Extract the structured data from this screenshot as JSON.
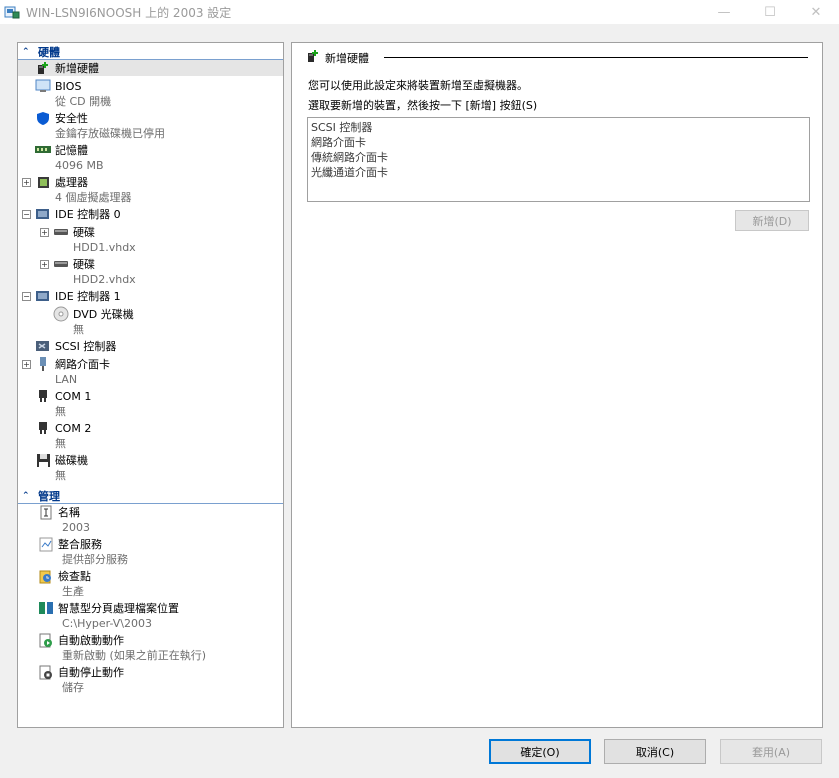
{
  "window": {
    "title": "WIN-LSN9I6NOOSH 上的 2003 設定",
    "minimize": "—",
    "maximize": "☐",
    "close": "✕"
  },
  "tree": {
    "hardware_section": "硬體",
    "hardware": [
      {
        "label": "新增硬體",
        "sub": "",
        "icon": "add-hardware-icon",
        "expand": "",
        "indent": 0,
        "selected": true
      },
      {
        "label": "BIOS",
        "sub": "從 CD 開機",
        "icon": "bios-icon",
        "expand": "",
        "indent": 0
      },
      {
        "label": "安全性",
        "sub": "金鑰存放磁碟機已停用",
        "icon": "shield-icon",
        "expand": "",
        "indent": 0
      },
      {
        "label": "記憶體",
        "sub": "4096 MB",
        "icon": "memory-icon",
        "expand": "",
        "indent": 0
      },
      {
        "label": "處理器",
        "sub": "4 個虛擬處理器",
        "icon": "processor-icon",
        "expand": "+",
        "indent": 0
      },
      {
        "label": "IDE 控制器 0",
        "sub": "",
        "icon": "ide-controller-icon",
        "expand": "−",
        "indent": 0
      },
      {
        "label": "硬碟",
        "sub": "HDD1.vhdx",
        "icon": "hard-drive-icon",
        "expand": "+",
        "indent": 1
      },
      {
        "label": "硬碟",
        "sub": "HDD2.vhdx",
        "icon": "hard-drive-icon",
        "expand": "+",
        "indent": 1
      },
      {
        "label": "IDE 控制器 1",
        "sub": "",
        "icon": "ide-controller-icon",
        "expand": "−",
        "indent": 0
      },
      {
        "label": "DVD 光碟機",
        "sub": "無",
        "icon": "dvd-icon",
        "expand": "",
        "indent": 1
      },
      {
        "label": "SCSI 控制器",
        "sub": "",
        "icon": "scsi-controller-icon",
        "expand": "",
        "indent": 0
      },
      {
        "label": "網路介面卡",
        "sub": "LAN",
        "icon": "network-adapter-icon",
        "expand": "+",
        "indent": 0
      },
      {
        "label": "COM 1",
        "sub": "無",
        "icon": "com-port-icon",
        "expand": "",
        "indent": 0
      },
      {
        "label": "COM 2",
        "sub": "無",
        "icon": "com-port-icon",
        "expand": "",
        "indent": 0
      },
      {
        "label": "磁碟機",
        "sub": "無",
        "icon": "floppy-icon",
        "expand": "",
        "indent": 0
      }
    ],
    "management_section": "管理",
    "management": [
      {
        "label": "名稱",
        "sub": "2003",
        "icon": "name-icon"
      },
      {
        "label": "整合服務",
        "sub": "提供部分服務",
        "icon": "integration-services-icon"
      },
      {
        "label": "檢查點",
        "sub": "生產",
        "icon": "checkpoint-icon"
      },
      {
        "label": "智慧型分頁處理檔案位置",
        "sub": "C:\\Hyper-V\\2003",
        "icon": "paging-file-icon"
      },
      {
        "label": "自動啟動動作",
        "sub": "重新啟動 (如果之前正在執行)",
        "icon": "auto-start-icon"
      },
      {
        "label": "自動停止動作",
        "sub": "儲存",
        "icon": "auto-stop-icon"
      }
    ]
  },
  "panel": {
    "title": "新增硬體",
    "description": "您可以使用此設定來將裝置新增至虛擬機器。",
    "instruction": "選取要新增的裝置，然後按一下 [新增] 按鈕(S)",
    "devices": [
      "SCSI 控制器",
      "網路介面卡",
      "傳統網路介面卡",
      "光纖通道介面卡"
    ],
    "add_button": "新增(D)"
  },
  "buttons": {
    "ok": "確定(O)",
    "cancel": "取消(C)",
    "apply": "套用(A)"
  }
}
